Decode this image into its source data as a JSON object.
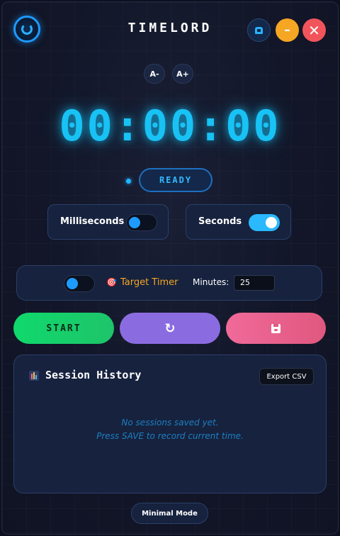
{
  "header": {
    "title": "TIMELORD",
    "pin_icon": "pin-icon",
    "minimize_label": "–",
    "close_label": "✕"
  },
  "font_controls": {
    "decrease_label": "A-",
    "increase_label": "A+"
  },
  "timer": {
    "display": "00:00:00"
  },
  "status": {
    "label": "READY"
  },
  "toggles": {
    "milliseconds": {
      "label": "Milliseconds",
      "on": false
    },
    "seconds": {
      "label": "Seconds",
      "on": true
    }
  },
  "target": {
    "enabled": false,
    "icon": "🎯",
    "label": "Target Timer",
    "minutes_label": "Minutes:",
    "minutes_value": "25"
  },
  "actions": {
    "start_label": "START",
    "reset_icon": "refresh-icon",
    "reset_glyph": "↻",
    "save_icon": "save-icon"
  },
  "history": {
    "title": "Session History",
    "export_label": "Export CSV",
    "empty_line1": "No sessions saved yet.",
    "empty_line2": "Press SAVE to record current time."
  },
  "footer": {
    "minimal_mode_label": "Minimal Mode"
  },
  "colors": {
    "accent": "#18c2f5",
    "start": "#10d96c",
    "reset": "#8b6ce0",
    "save": "#e0587f",
    "target_label": "#f5a623",
    "minimize": "#f5a623",
    "close": "#f2545b"
  }
}
